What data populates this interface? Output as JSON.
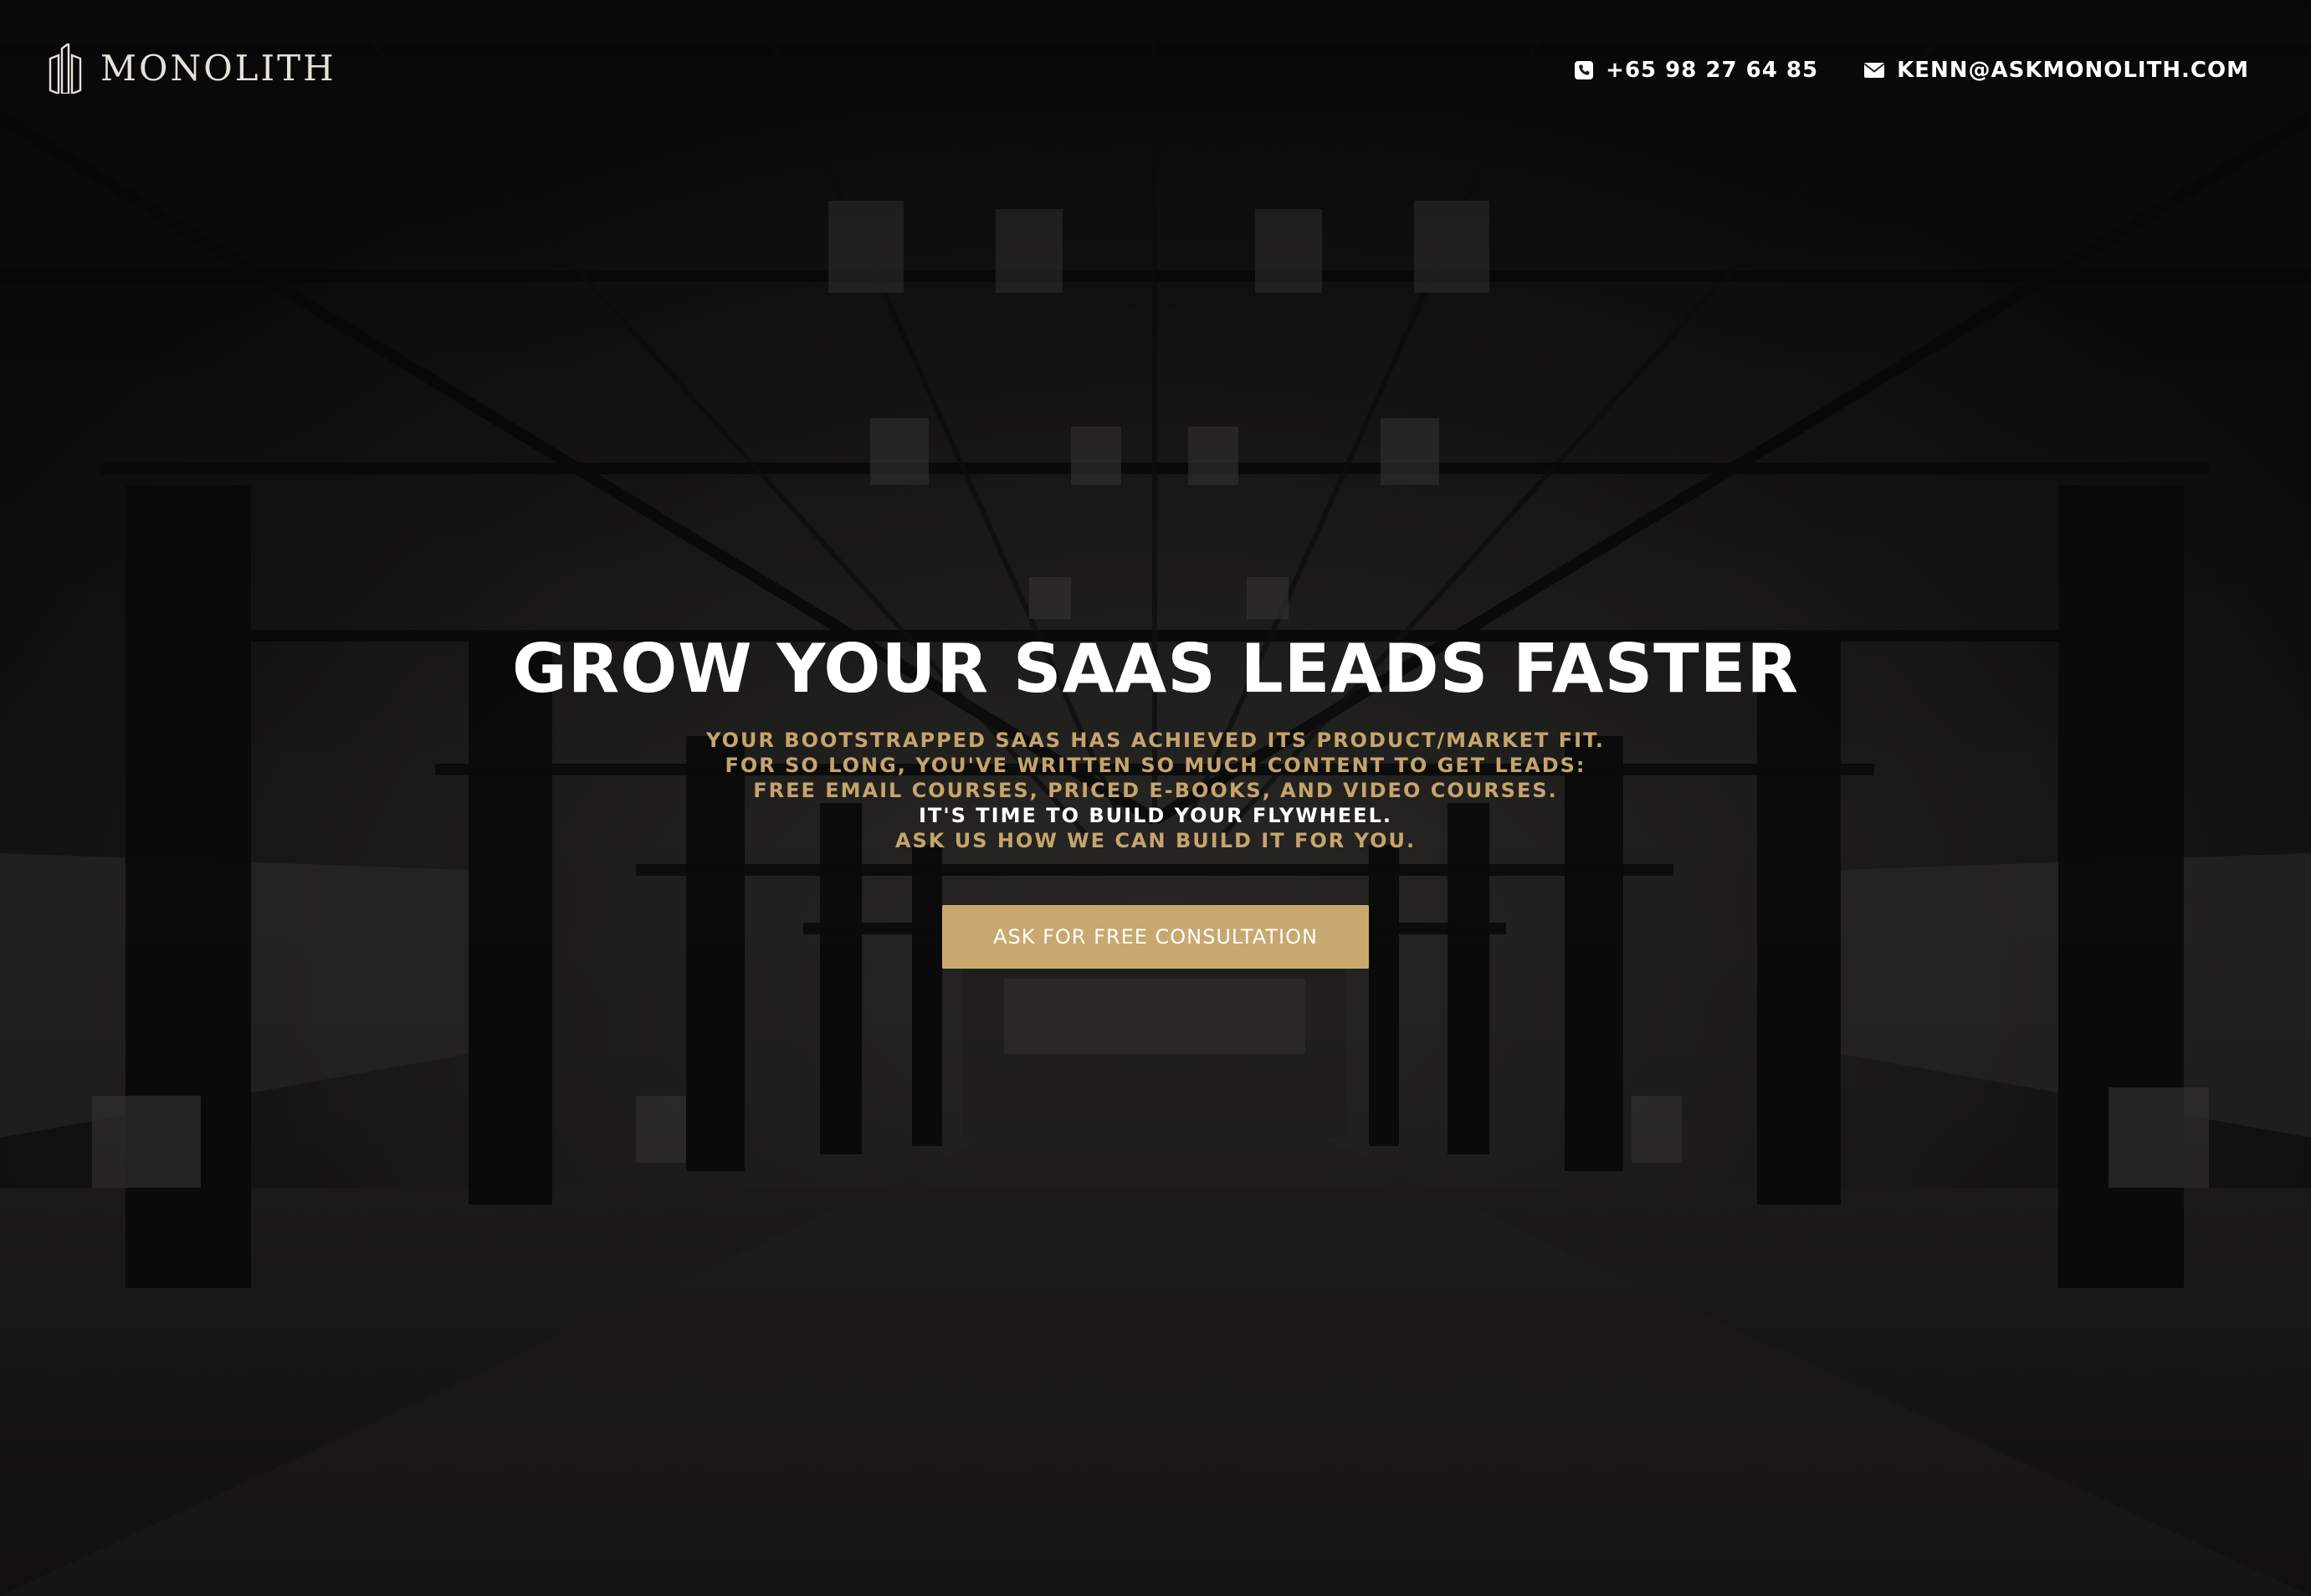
{
  "brand": {
    "name": "MONOLITH",
    "logo_icon": "monolith-pillars-icon"
  },
  "header": {
    "phone": {
      "icon": "phone-icon",
      "text": "+65 98 27 64 85"
    },
    "email": {
      "icon": "envelope-icon",
      "text": "KENN@ASKMONOLITH.COM"
    }
  },
  "hero": {
    "title": "GROW YOUR SAAS LEADS FASTER",
    "lines": [
      "YOUR BOOTSTRAPPED SAAS HAS ACHIEVED ITS PRODUCT/MARKET FIT.",
      "FOR SO LONG, YOU'VE WRITTEN SO MUCH CONTENT TO GET LEADS:",
      "FREE EMAIL COURSES, PRICED E-BOOKS, AND VIDEO COURSES.",
      "IT'S TIME TO BUILD YOUR FLYWHEEL.",
      "ASK US HOW WE CAN BUILD IT FOR YOU."
    ],
    "cta_label": "ASK FOR FREE CONSULTATION"
  },
  "colors": {
    "accent_gold": "#c8a86f",
    "subtitle_gold": "#c6a46b",
    "text_white": "#ffffff",
    "background_dark": "#1c1b1a"
  }
}
